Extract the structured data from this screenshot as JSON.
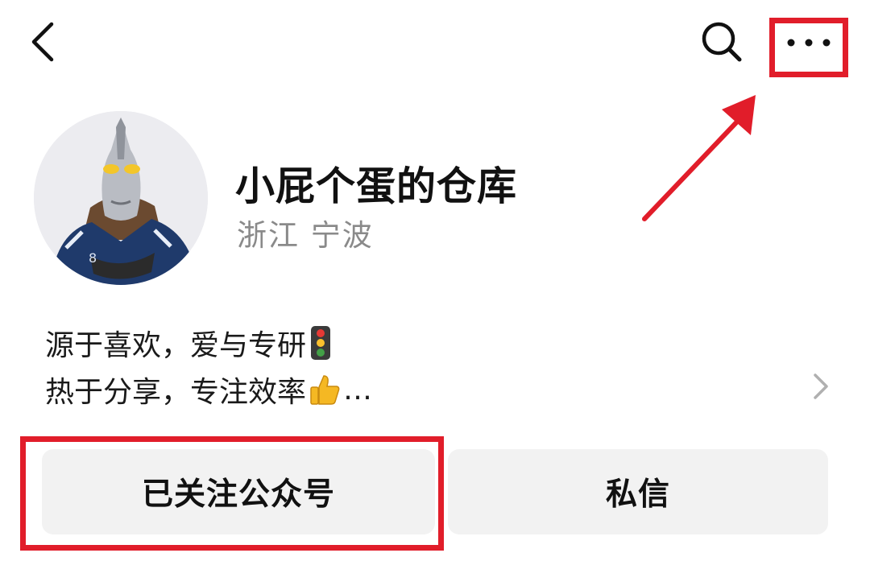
{
  "header": {
    "back_icon": "back-chevron-icon",
    "search_icon": "search-icon",
    "more_icon": "more-dots-icon"
  },
  "profile": {
    "name": "小屁个蛋的仓库",
    "location": "浙江 宁波",
    "avatar_icon": "ultraman-avatar"
  },
  "bio": {
    "line1": "源于喜欢，爱与专研",
    "line1_emoji": "traffic-light-icon",
    "line2": "热于分享，专注效率",
    "line2_emoji": "thumbs-up-icon",
    "line2_suffix": "…"
  },
  "actions": {
    "followed_label": "已关注公众号",
    "message_label": "私信"
  },
  "colors": {
    "highlight": "#e11d2a",
    "button_bg": "#f2f2f2",
    "secondary_text": "#8a8a8a"
  }
}
